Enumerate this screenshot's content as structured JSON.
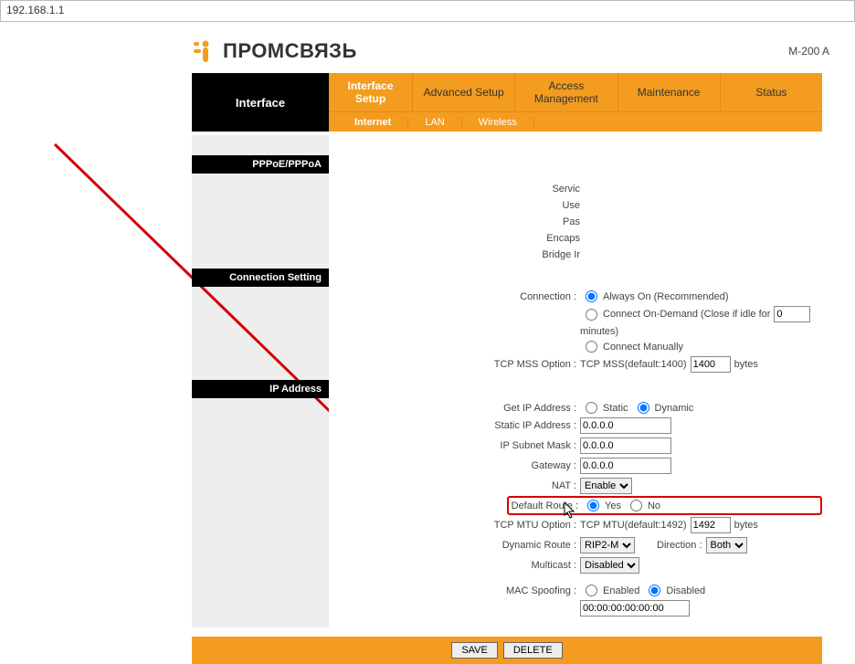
{
  "address_bar": "192.168.1.1",
  "brand": "ПРОМСВЯЗЬ",
  "model": "M-200 A",
  "tabs": {
    "active": "Interface",
    "items": [
      "Interface Setup",
      "Advanced Setup",
      "Access Management",
      "Maintenance",
      "Status"
    ]
  },
  "subnav": [
    "Internet",
    "LAN",
    "Wireless"
  ],
  "sections": {
    "pppoe": "PPPoE/PPPoA",
    "conn": "Connection Setting",
    "ip": "IP Address"
  },
  "truncated": {
    "servic": "Servic",
    "use": "Use",
    "pas": "Pas",
    "encaps": "Encaps",
    "bridge": "Bridge Ir"
  },
  "conn": {
    "label": "Connection :",
    "always": "Always On (Recommended)",
    "ondemand": "Connect On-Demand (Close if idle for",
    "ondemand_value": "0",
    "minutes": "minutes)",
    "manual": "Connect Manually",
    "tcpmss_label": "TCP MSS Option :",
    "tcpmss_prefix": "TCP MSS(default:1400)",
    "tcpmss_value": "1400",
    "bytes": "bytes"
  },
  "ip": {
    "getip_label": "Get IP Address :",
    "static": "Static",
    "dynamic": "Dynamic",
    "staticip_label": "Static IP Address :",
    "staticip_value": "0.0.0.0",
    "subnet_label": "IP Subnet Mask :",
    "subnet_value": "0.0.0.0",
    "gateway_label": "Gateway :",
    "gateway_value": "0.0.0.0",
    "nat_label": "NAT :",
    "nat_value": "Enable",
    "defroute_label": "Default Route :",
    "yes": "Yes",
    "no": "No",
    "mtu_label": "TCP MTU Option :",
    "mtu_prefix": "TCP MTU(default:1492)",
    "mtu_value": "1492",
    "dynroute_label": "Dynamic Route :",
    "dynroute_value": "RIP2-M",
    "direction_label": "Direction :",
    "direction_value": "Both",
    "multicast_label": "Multicast :",
    "multicast_value": "Disabled",
    "macspoof_label": "MAC Spoofing :",
    "enabled": "Enabled",
    "disabled": "Disabled",
    "mac_value": "00:00:00:00:00:00"
  },
  "footer": {
    "save": "SAVE",
    "delete": "DELETE"
  }
}
